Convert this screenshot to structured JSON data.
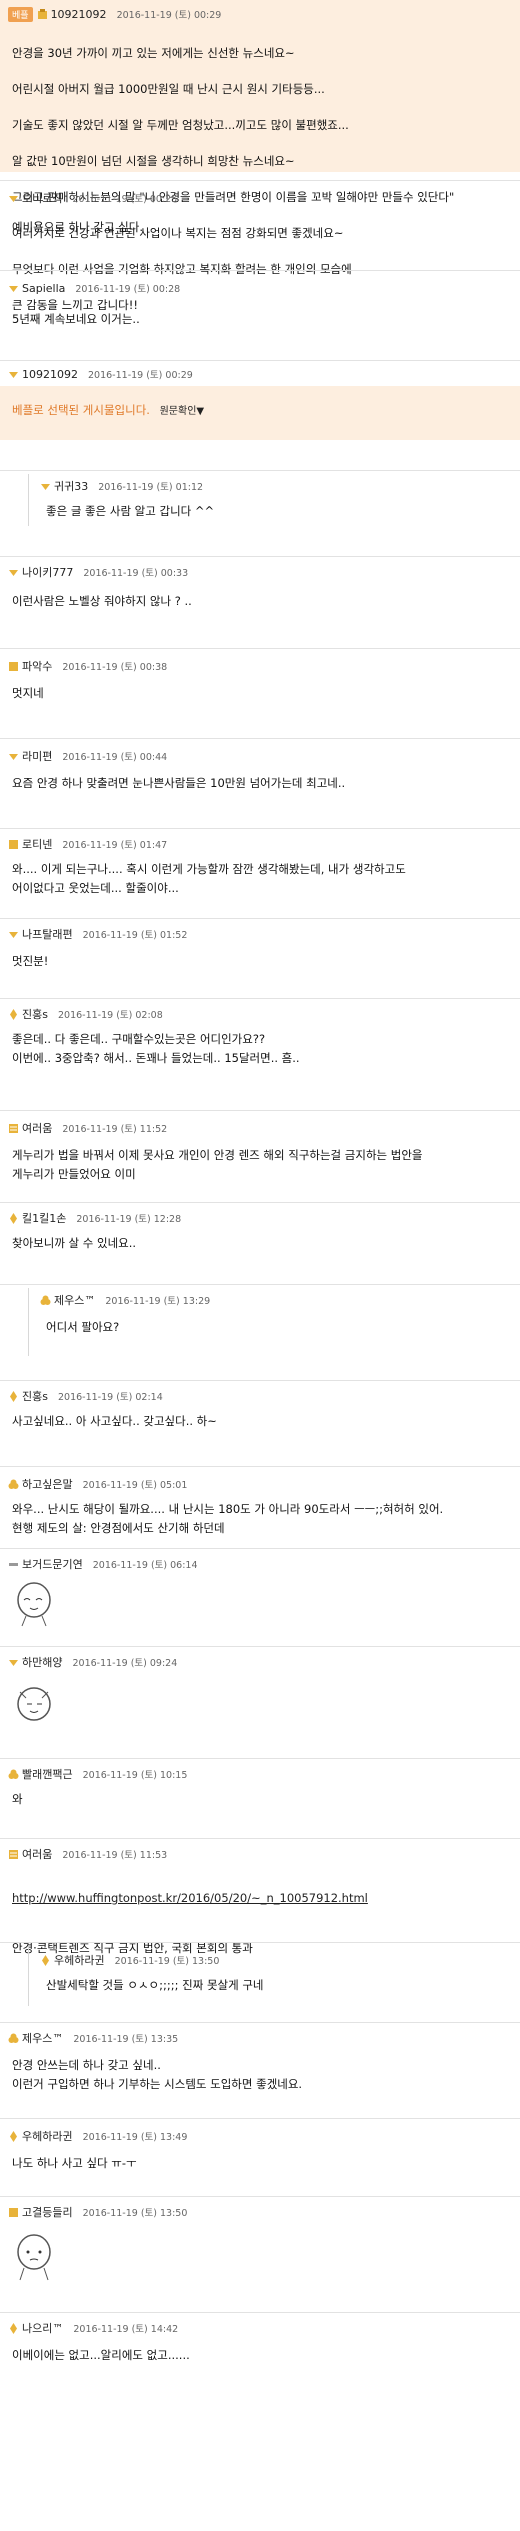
{
  "header": {
    "badge": "베플"
  },
  "best_post": {
    "nick": "10921092",
    "date": "2016-11-19 (토) 00:29",
    "lines": [
      "안경을 30년 가까이 끼고 있는 저에게는 신선한 뉴스네요~",
      "어린시절 아버지 월급 1000만원일 때 난시 근시 원시 기타등등...",
      "기술도 좋지 않았던 시절 알 두께만 엄청났고...끼고도 많이 불편했죠...",
      "알 값만 10만원이 넘던 시절을 생각하니 희망찬 뉴스네요~",
      "그리고 판매하시는분의 말 \"니 안경을 만들려면 한명이 이름을 꼬박 일해야만 만들수 있단다\"",
      "여러가지로 건강과 연관된 사업이나 복지는 점점 강화되면 좋겠네요~",
      "무엇보다 이런 사업을 기업화 하지않고 복지화 할려는 한 개인의 모습에",
      "큰 감동을 느끼고 갑니다!!"
    ]
  },
  "comments": [
    {
      "nick": "오비로직",
      "date": "2016-11-19 (토) 00:25",
      "body": "예비용으로 하나 갖고 싶다."
    },
    {
      "nick": "Sapiella",
      "date": "2016-11-19 (토) 00:28",
      "body": "5년째 계속보네요 이거는.."
    },
    {
      "nick": "10921092",
      "date": "2016-11-19 (토) 00:29",
      "best_note": "베플로 선택된 게시물입니다.",
      "best_link": "원문확인▼"
    },
    {
      "nick": "귀귀33",
      "date": "2016-11-19 (토) 01:12",
      "body": "좋은 글 좋은 사람 알고 갑니다 ^^",
      "reply": true
    },
    {
      "nick": "나이키777",
      "date": "2016-11-19 (토) 00:33",
      "body": "이런사람은 노벨상 줘야하지 않나 ? .."
    },
    {
      "nick": "파악수",
      "date": "2016-11-19 (토) 00:38",
      "body": "멋지네"
    },
    {
      "nick": "라미편",
      "date": "2016-11-19 (토) 00:44",
      "body": "요즘 안경 하나 맞출려면 눈나쁜사람들은 10만원 넘어가는데 최고네.."
    },
    {
      "nick": "로티넨",
      "date": "2016-11-19 (토) 01:47",
      "body": "와.... 이게 되는구나.... 혹시 이런게 가능할까 잠깐 생각해봤는데, 내가 생각하고도\n 어이없다고 웃었는데... 할줄이야..."
    },
    {
      "nick": "나프탈래편",
      "date": "2016-11-19 (토) 01:52",
      "body": "멋진분!"
    },
    {
      "nick": "진홍s",
      "date": "2016-11-19 (토) 02:08",
      "body": "좋은데.. 다 좋은데.. 구매할수있는곳은 어디인가요??\n이번에.. 3중압축? 해서.. 돈꽤나 들었는데.. 15달러면.. 흠.."
    },
    {
      "nick": "여러움",
      "date": "2016-11-19 (토) 11:52",
      "body": "게누리가 법을 바꿔서 이제 못사요 개인이 안경 렌즈 해외 직구하는걸 금지하는 법안을\n게누리가 만들었어요 이미"
    },
    {
      "nick": "킬1킬1손",
      "date": "2016-11-19 (토) 12:28",
      "body": "찾아보니까 살 수 있네요.."
    },
    {
      "nick": "제우스™",
      "date": "2016-11-19 (토) 13:29",
      "body": "어디서 팔아요?",
      "reply": true
    },
    {
      "nick": "진홍s",
      "date": "2016-11-19 (토) 02:14",
      "body": "사고싶네요.. 아 사고싶다.. 갖고싶다.. 하~"
    },
    {
      "nick": "하고싶은말",
      "date": "2016-11-19 (토) 05:01",
      "body": "와우... 난시도 해당이 될까요.... 내 난시는 180도 가 아니라 90도라서 ㅡㅡ;;혀허허 있어.\n 현행 제도의 살: 안경점에서도 산기해 하던데"
    },
    {
      "nick": "보거드문기연",
      "date": "2016-11-19 (토) 06:14",
      "body": "",
      "avatar": true
    },
    {
      "nick": "하만해양",
      "date": "2016-11-19 (토) 09:24",
      "body": "",
      "avatar": true
    },
    {
      "nick": "빨래깬팩근",
      "date": "2016-11-19 (토) 10:15",
      "body": "와"
    },
    {
      "nick": "여러움",
      "date": "2016-11-19 (토) 11:53",
      "link": "http://www.huffingtonpost.kr/2016/05/20/~_n_10057912.html",
      "body": "안경·콘택트렌즈 직구 금지 법안, 국회 본회의 통과"
    },
    {
      "nick": "우헤하라귄",
      "date": "2016-11-19 (토) 13:50",
      "body": "산발세탁할 것들 ㅇㅅㅇ;;;;; 진짜 못살게 구네",
      "reply": true
    },
    {
      "nick": "제우스™",
      "date": "2016-11-19 (토) 13:35",
      "body": "안경 안쓰는데 하나 갖고 싶네..\n이런거 구입하면 하나 기부하는 시스템도 도입하면 좋겠네요."
    },
    {
      "nick": "우헤하라귄",
      "date": "2016-11-19 (토) 13:49",
      "body": "나도 하나 사고 싶다 ㅠ-ㅜ"
    },
    {
      "nick": "고결등들리",
      "date": "2016-11-19 (토) 13:50",
      "body": "",
      "avatar": true
    },
    {
      "nick": "나으리™",
      "date": "2016-11-19 (토) 14:42",
      "body": "이베이에는 없고...알리에도 없고......"
    }
  ],
  "colors": {
    "highlight": "#fdeedf",
    "separator": "#e2e2e2",
    "best_text": "#e07a2a",
    "badge": "#f0a050",
    "icon_gold": "#e8b33a"
  }
}
